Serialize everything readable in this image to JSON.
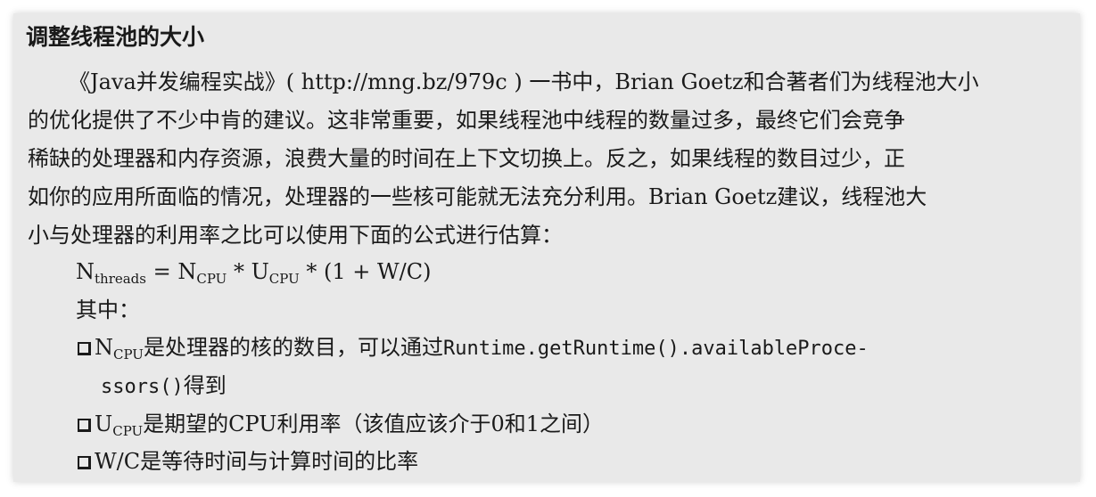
{
  "section": {
    "title": "调整线程池的大小"
  },
  "paragraph": {
    "lines": [
      "《Java并发编程实战》( http://mng.bz/979c ) 一书中，Brian  Goetz和合著者们为线程池大小",
      "的优化提供了不少中肯的建议。这非常重要，如果线程池中线程的数量过多，最终它们会竞争",
      "稀缺的处理器和内存资源，浪费大量的时间在上下文切换上。反之，如果线程的数目过少，正",
      "如你的应用所面临的情况，处理器的一些核可能就无法充分利用。Brian Goetz建议，线程池大",
      "小与处理器的利用率之比可以使用下面的公式进行估算："
    ]
  },
  "formula": {
    "n": "N",
    "n_sub": "threads",
    "eq": " = N",
    "ncpu_sub": "CPU",
    "times1": " * U",
    "ucpu_sub": "CPU",
    "rest": " * (1 + W/C)"
  },
  "where_label": "其中：",
  "bullets": {
    "b1_n": "N",
    "b1_sub": "CPU",
    "b1_text": "是处理器的核的数目，可以通过",
    "b1_code": "Runtime.getRuntime().availableProce-",
    "b1_code_cont": "ssors()",
    "b1_tail": "得到",
    "b2_u": "U",
    "b2_sub": "CPU",
    "b2_text": "是期望的CPU利用率（该值应该介于0和1之间）",
    "b3_text": "W/C是等待时间与计算时间的比率"
  }
}
